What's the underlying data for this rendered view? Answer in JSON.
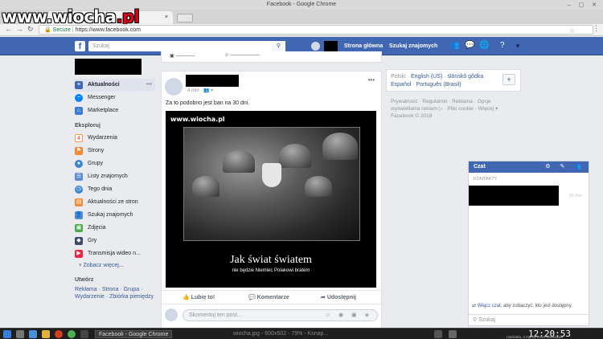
{
  "browser": {
    "window_title": "Facebook - Google Chrome",
    "tab_title": "Facebook",
    "tab_close": "×",
    "secure_label": "Secure",
    "url": "https://www.facebook.com",
    "back": "←",
    "forward": "→",
    "reload": "↻",
    "star": "☆",
    "menu": "⋮",
    "window_buttons": "– ▢ ✕"
  },
  "watermark": {
    "text": "www.wiocha",
    "tld": ".pl"
  },
  "fb_header": {
    "search_placeholder": "Szukaj",
    "home_link": "Strona główna",
    "find_friends_link": "Szukaj znajomych",
    "icons": [
      "friends-icon",
      "messenger-icon",
      "notifications-icon",
      "help-icon",
      "dropdown-icon"
    ]
  },
  "left_nav": {
    "items": [
      {
        "label": "Aktualności",
        "icon": "news-feed-icon"
      },
      {
        "label": "Messenger",
        "icon": "messenger-icon"
      },
      {
        "label": "Marketplace",
        "icon": "marketplace-icon"
      }
    ],
    "explore_title": "Eksploruj",
    "explore_items": [
      {
        "label": "Wydarzenia",
        "icon": "events-icon"
      },
      {
        "label": "Strony",
        "icon": "pages-icon"
      },
      {
        "label": "Grupy",
        "icon": "groups-icon"
      },
      {
        "label": "Listy znajomych",
        "icon": "friend-lists-icon"
      },
      {
        "label": "Tego dnia",
        "icon": "on-this-day-icon"
      },
      {
        "label": "Aktualności ze stron",
        "icon": "pages-feed-icon"
      },
      {
        "label": "Szukaj znajomych",
        "icon": "find-friends-icon"
      },
      {
        "label": "Zdjęcia",
        "icon": "photos-icon"
      },
      {
        "label": "Gry",
        "icon": "games-icon"
      },
      {
        "label": "Transmisja wideo n...",
        "icon": "live-video-icon"
      }
    ],
    "see_more": "Zobacz więcej...",
    "create_title": "Utwórz",
    "create_links": "Reklama · Strona · Grupa · Wydarzenie · Zbiórka pieniędzy"
  },
  "post": {
    "meta": "4 min · 👥 ▾",
    "text": "Za to podobno jest ban na 30 dni.",
    "image_watermark": "www.wiocha.pl",
    "demotivator_title": "Jak świat światem",
    "demotivator_subtitle": "nie będzie Niemiec Polakowi bratem",
    "like": "Lubię to!",
    "comment": "Komentarze",
    "share": "Udostępnij",
    "comment_placeholder": "Skomentuj ten post..."
  },
  "languages": {
    "current": "Polski",
    "sep": "·",
    "links": [
      "English (US)",
      "ślōnskŏ gŏdka",
      "Español",
      "Português (Brasil)"
    ],
    "add": "+"
  },
  "footer": "Prywatność · Regulamin · Reklama · Opcje wyświetlania reklam ▷ · Pliki cookie · Więcej ▾ Facebook © 2018",
  "chat": {
    "title": "Czat",
    "contacts_header": "KONTAKTY",
    "contact_time": "33 min",
    "info_link": "Włącz czat",
    "info_rest": ", aby zobaczyć, kto jest dostępny.",
    "search": "Szukaj"
  },
  "taskbar": {
    "window1": "Facebook - Google Chrome",
    "window2": "wiocha.jpg - 600x502 - 79% - Ksnap...",
    "clock": "12:20:53",
    "date": "niedziela, 4 marca 2018 Warszawa"
  },
  "colors": {
    "fb_blue": "#4267b2",
    "link": "#365899",
    "page_bg": "#e9ebee"
  }
}
